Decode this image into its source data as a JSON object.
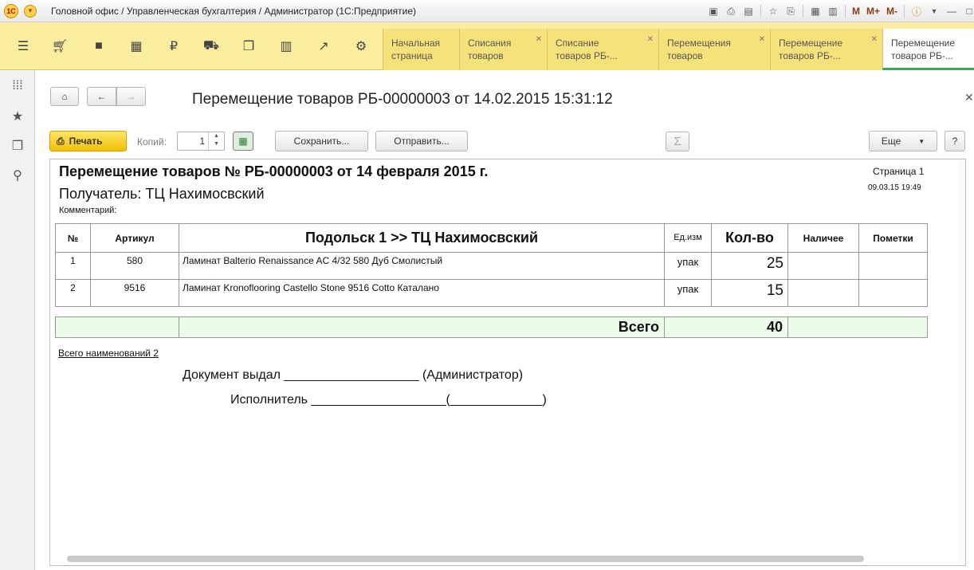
{
  "window": {
    "title": "Головной офис / Управленческая бухгалтерия / Администратор  (1С:Предприятие)",
    "app_icon": "1C",
    "toolbar_m_labels": [
      "M",
      "M+",
      "M-"
    ]
  },
  "tabs": [
    {
      "label_line1": "Начальная",
      "label_line2": "страница",
      "closable": false
    },
    {
      "label_line1": "Списания",
      "label_line2": "товаров",
      "closable": true
    },
    {
      "label_line1": "Списание",
      "label_line2": "товаров РБ-...",
      "closable": true
    },
    {
      "label_line1": "Перемещения",
      "label_line2": "товаров",
      "closable": true
    },
    {
      "label_line1": "Перемещение",
      "label_line2": "товаров РБ-...",
      "closable": true
    },
    {
      "label_line1": "Перемещение",
      "label_line2": "товаров РБ-...",
      "closable": false
    }
  ],
  "header": {
    "doc_title": "Перемещение товаров РБ-00000003 от 14.02.2015 15:31:12"
  },
  "toolbar": {
    "print_label": "Печать",
    "copies_label": "Копий:",
    "copies_value": "1",
    "save_label": "Сохранить...",
    "send_label": "Отправить...",
    "more_label": "Еще",
    "help_label": "?",
    "sum_symbol": "Σ"
  },
  "report": {
    "title": "Перемещение товаров № РБ-00000003 от 14 февраля 2015 г.",
    "recipient": "Получатель: ТЦ Нахимосвский",
    "comment_label": "Комментарий:",
    "page": "Страница 1",
    "printed_at": "09.03.15 19:49",
    "columns": {
      "num": "№",
      "article": "Артикул",
      "route": "Подольск 1 >> ТЦ Нахимосвский",
      "unit": "Ед.изм",
      "qty": "Кол-во",
      "stock": "Наличее",
      "notes": "Пометки"
    },
    "rows": [
      {
        "num": "1",
        "article": "580",
        "name": "Ламинат Balterio Renaissance AC 4/32 580 Дуб Смолистый",
        "unit": "упак",
        "qty": "25"
      },
      {
        "num": "2",
        "article": "9516",
        "name": "Ламинат Kronoflooring Castello Stone 9516 Cotto Каталано",
        "unit": "упак",
        "qty": "15"
      }
    ],
    "total_label": "Всего",
    "total_qty": "40",
    "total_names": "Всего наименований 2",
    "issued_by": "Документ выдал  ___________________ (Администратор)",
    "executor": "Исполнитель  ___________________(_____________)"
  }
}
